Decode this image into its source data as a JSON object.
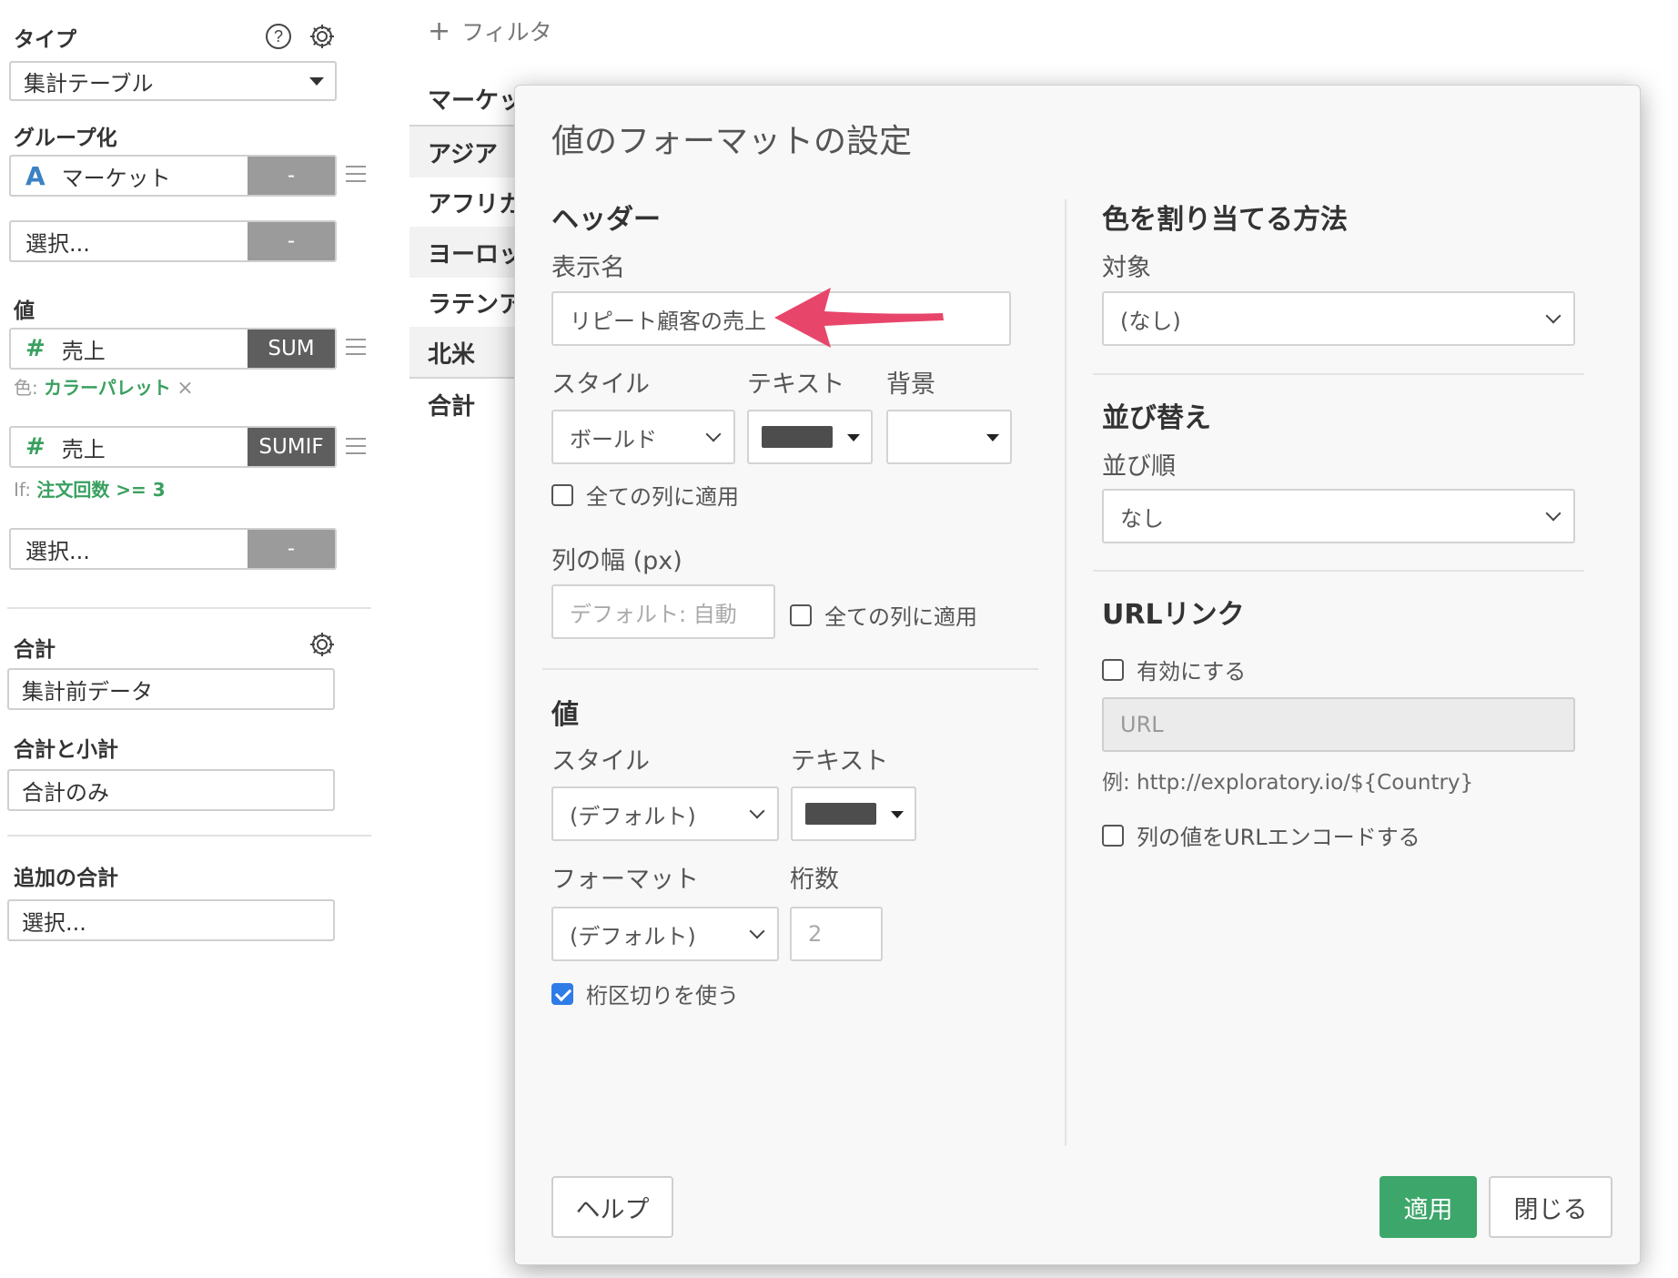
{
  "left_panel": {
    "type_label": "タイプ",
    "type_value": "集計テーブル",
    "group_label": "グループ化",
    "group_field": "マーケット",
    "group_field_btn": "-",
    "group_select": "選択...",
    "group_select_btn": "-",
    "value_label": "値",
    "value_field1": "売上",
    "value_field1_btn": "SUM",
    "color_note_prefix": "色:",
    "color_note_value": "カラーパレット",
    "color_note_remove": "×",
    "value_field2": "売上",
    "value_field2_btn": "SUMIF",
    "if_note_prefix": "If:",
    "if_note_value": "注文回数 >= 3",
    "value_select": "選択...",
    "value_select_btn": "-",
    "total_label": "合計",
    "total_value": "集計前データ",
    "subtotal_label": "合計と小計",
    "subtotal_value": "合計のみ",
    "extra_label": "追加の合計",
    "extra_value": "選択..."
  },
  "table": {
    "filter_label": "フィルタ",
    "rows": [
      "マーケット",
      "アジア",
      "アフリカ",
      "ヨーロッパ",
      "ラテンアメリカ",
      "北米",
      "合計"
    ]
  },
  "modal": {
    "title": "値のフォーマットの設定",
    "header_section": "ヘッダー",
    "display_name_label": "表示名",
    "display_name_value": "リピート顧客の売上",
    "style_label": "スタイル",
    "text_label": "テキスト",
    "bg_label": "背景",
    "style_value": "ボールド",
    "apply_all_cols": "全ての列に適用",
    "col_width_label": "列の幅 (px)",
    "col_width_placeholder": "デフォルト: 自動",
    "apply_all_cols2": "全ての列に適用",
    "value_section": "値",
    "value_style_label": "スタイル",
    "value_text_label": "テキスト",
    "value_style_value": "(デフォルト)",
    "format_label": "フォーマット",
    "digits_label": "桁数",
    "format_value": "(デフォルト)",
    "digits_value": "2",
    "thousands_sep": "桁区切りを使う",
    "color_section": "色を割り当てる方法",
    "target_label": "対象",
    "target_value": "(なし)",
    "sort_section": "並び替え",
    "sort_order_label": "並び順",
    "sort_order_value": "なし",
    "url_section": "URLリンク",
    "enable_label": "有効にする",
    "url_placeholder": "URL",
    "url_example": "例: http://exploratory.io/${Country}",
    "url_encode_label": "列の値をURLエンコードする",
    "help_btn": "ヘルプ",
    "apply_btn": "適用",
    "close_btn": "閉じる",
    "checkbox_states": {
      "apply_all_cols": false,
      "apply_all_cols2": false,
      "thousands_sep": true,
      "enable": false,
      "url_encode": false
    }
  },
  "colors": {
    "accent_green": "#3da66a",
    "field_green": "#39a05f",
    "field_blue": "#3b82c4",
    "arrow_pink": "#e8456b",
    "checkbox_blue": "#2f7ce8"
  }
}
